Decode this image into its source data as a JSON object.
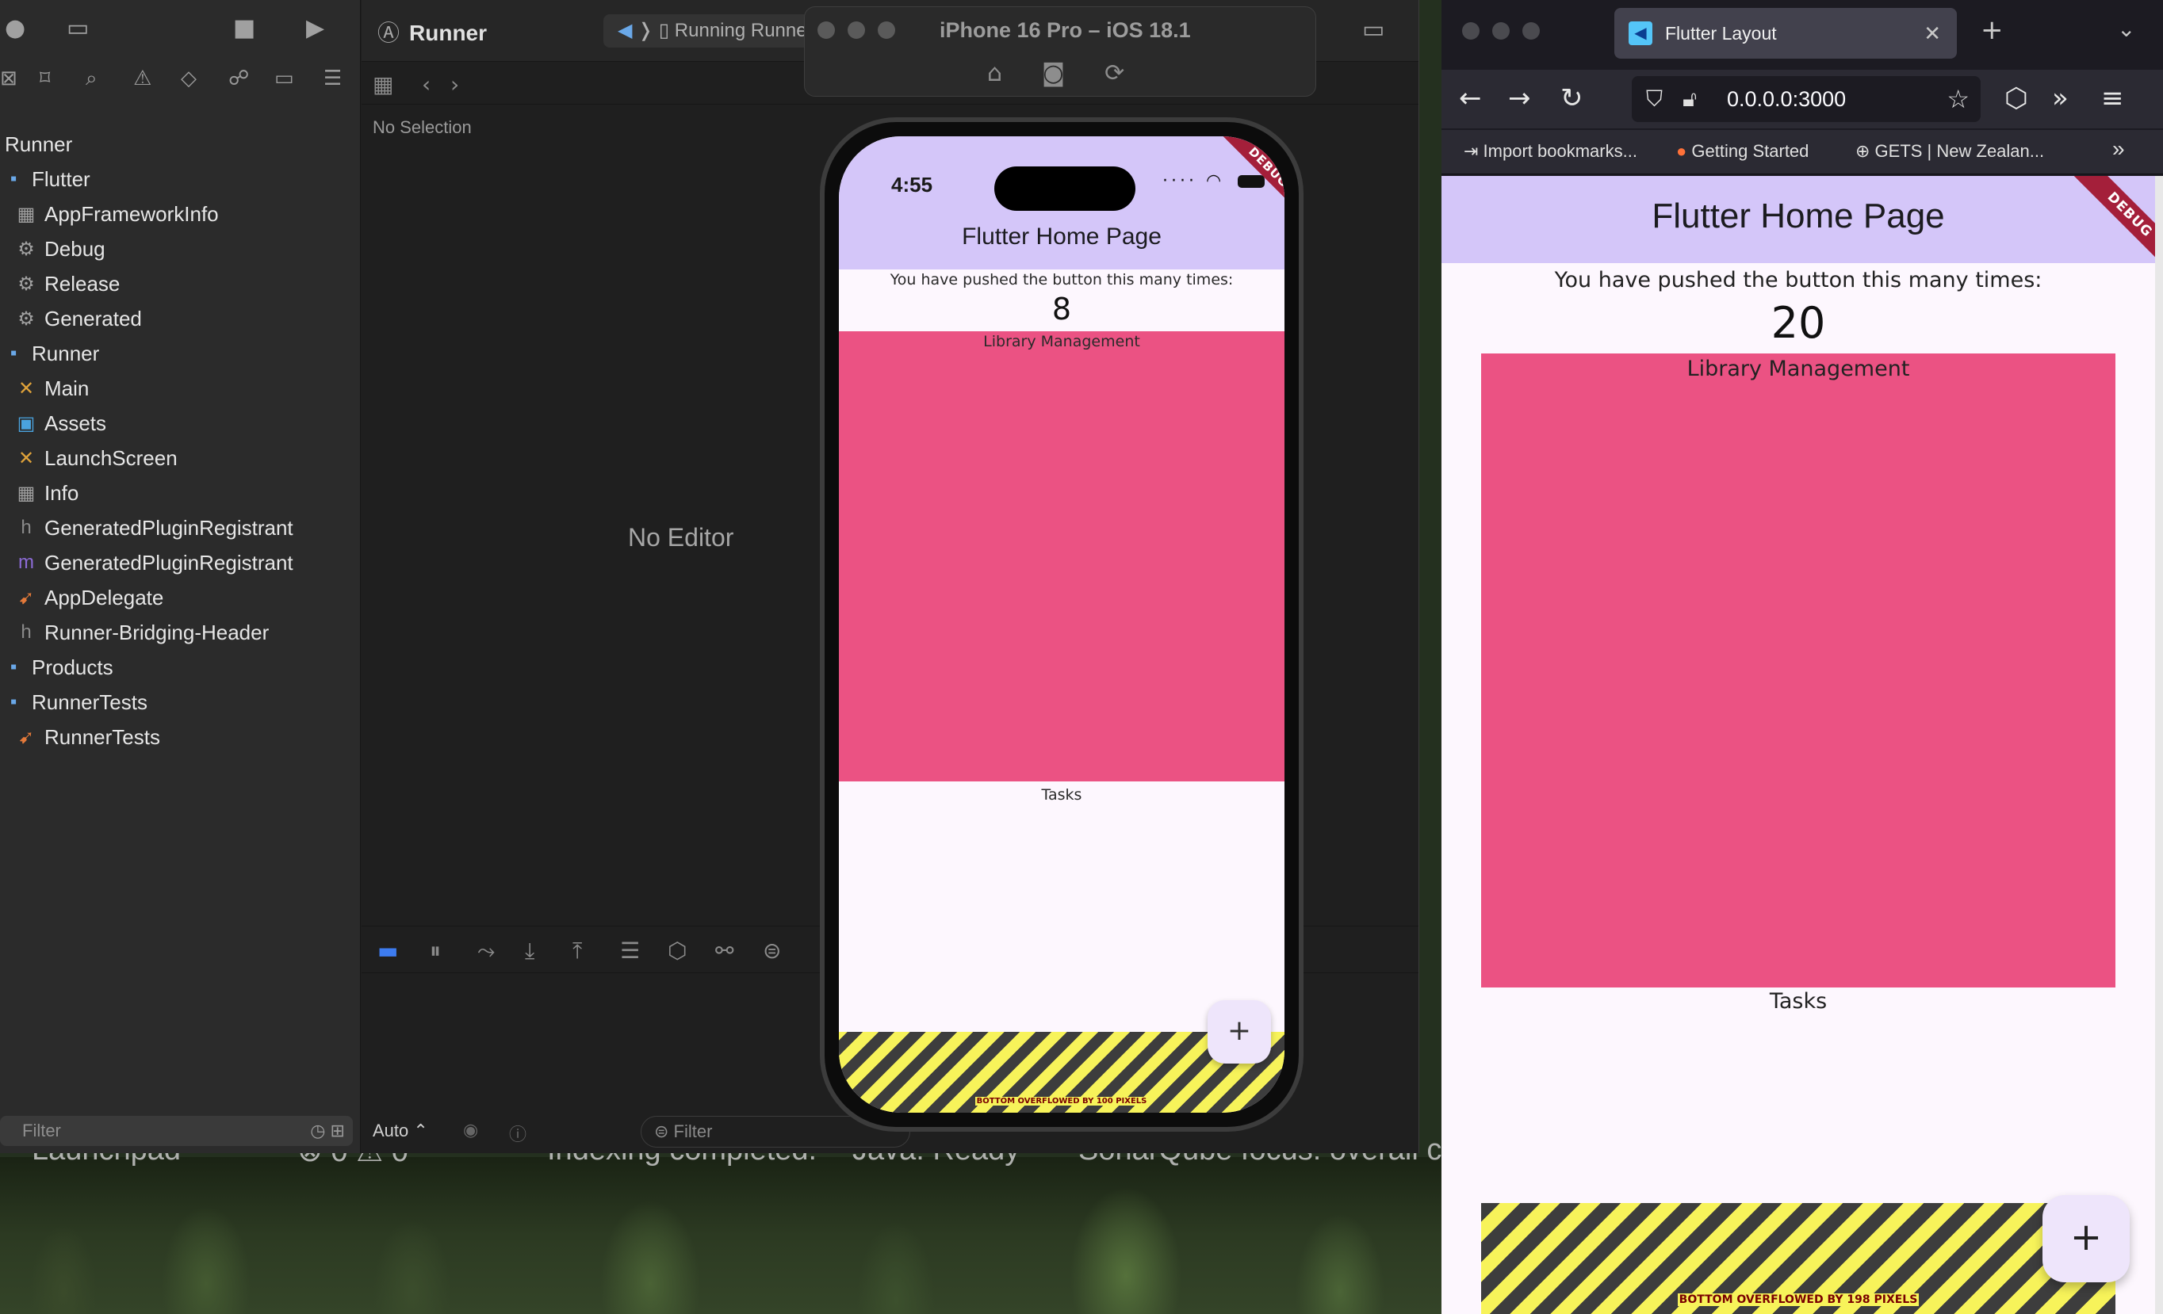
{
  "xcode": {
    "project_title": "Runner",
    "scheme_label": "Running Runner",
    "jumpbar_status": "No Selection",
    "no_editor": "No Editor",
    "filter_placeholder": "Filter",
    "debug_filter_placeholder": "Filter",
    "auto_label": "Auto ⌃",
    "tree": [
      {
        "label": "Runner",
        "icon": "project-icon",
        "level": 0
      },
      {
        "label": "Flutter",
        "icon": "folder-icon",
        "level": 1
      },
      {
        "label": "AppFrameworkInfo",
        "icon": "plist-icon",
        "level": 2
      },
      {
        "label": "Debug",
        "icon": "config-icon",
        "level": 2
      },
      {
        "label": "Release",
        "icon": "config-icon",
        "level": 2
      },
      {
        "label": "Generated",
        "icon": "config-icon",
        "level": 2
      },
      {
        "label": "Runner",
        "icon": "folder-icon",
        "level": 1
      },
      {
        "label": "Main",
        "icon": "storyboard-icon",
        "level": 2
      },
      {
        "label": "Assets",
        "icon": "assets-icon",
        "level": 2
      },
      {
        "label": "LaunchScreen",
        "icon": "storyboard-icon",
        "level": 2
      },
      {
        "label": "Info",
        "icon": "plist-icon",
        "level": 2
      },
      {
        "label": "GeneratedPluginRegistrant",
        "icon": "header-file-icon",
        "level": 2
      },
      {
        "label": "GeneratedPluginRegistrant",
        "icon": "objc-file-icon",
        "level": 2
      },
      {
        "label": "AppDelegate",
        "icon": "swift-file-icon",
        "level": 2
      },
      {
        "label": "Runner-Bridging-Header",
        "icon": "header-file-icon",
        "level": 2
      },
      {
        "label": "Products",
        "icon": "folder-icon",
        "level": 1
      },
      {
        "label": "RunnerTests",
        "icon": "folder-icon",
        "level": 1
      },
      {
        "label": "RunnerTests",
        "icon": "swift-file-icon",
        "level": 2
      }
    ]
  },
  "background_status": {
    "launchpad": "Launchpad",
    "counts": "⊗ 0 ⚠ 0",
    "indexing": "Indexing completed.",
    "java": "Java: Ready",
    "sonar": "SonarQube focus: overall co"
  },
  "simulator": {
    "title": "iPhone 16 Pro – iOS 18.1",
    "status_time": "4:55",
    "app_title": "Flutter Home Page",
    "counter_text": "You have pushed the button this many times:",
    "counter_value": "8",
    "library_label": "Library Management",
    "tasks_label": "Tasks",
    "overflow_text": "BOTTOM OVERFLOWED BY 100 PIXELS",
    "debug_banner": "DEBUG",
    "fab_label": "+"
  },
  "browser": {
    "tab_title": "Flutter Layout",
    "url": "0.0.0.0:3000",
    "bookmarks": [
      "Import bookmarks...",
      "Getting Started",
      "GETS | New Zealan..."
    ],
    "app_title": "Flutter Home Page",
    "counter_text": "You have pushed the button this many times:",
    "counter_value": "20",
    "library_label": "Library Management",
    "tasks_label": "Tasks",
    "overflow_text": "BOTTOM OVERFLOWED BY 198 PIXELS",
    "debug_banner": "DEBUG",
    "fab_label": "+"
  },
  "colors": {
    "app_bar": "#d4c6f9",
    "pink_block": "#eb5283",
    "overflow_yellow": "#f7f35a",
    "overflow_dark": "#3d3d3d",
    "debug_ribbon": "#a41f3a"
  }
}
